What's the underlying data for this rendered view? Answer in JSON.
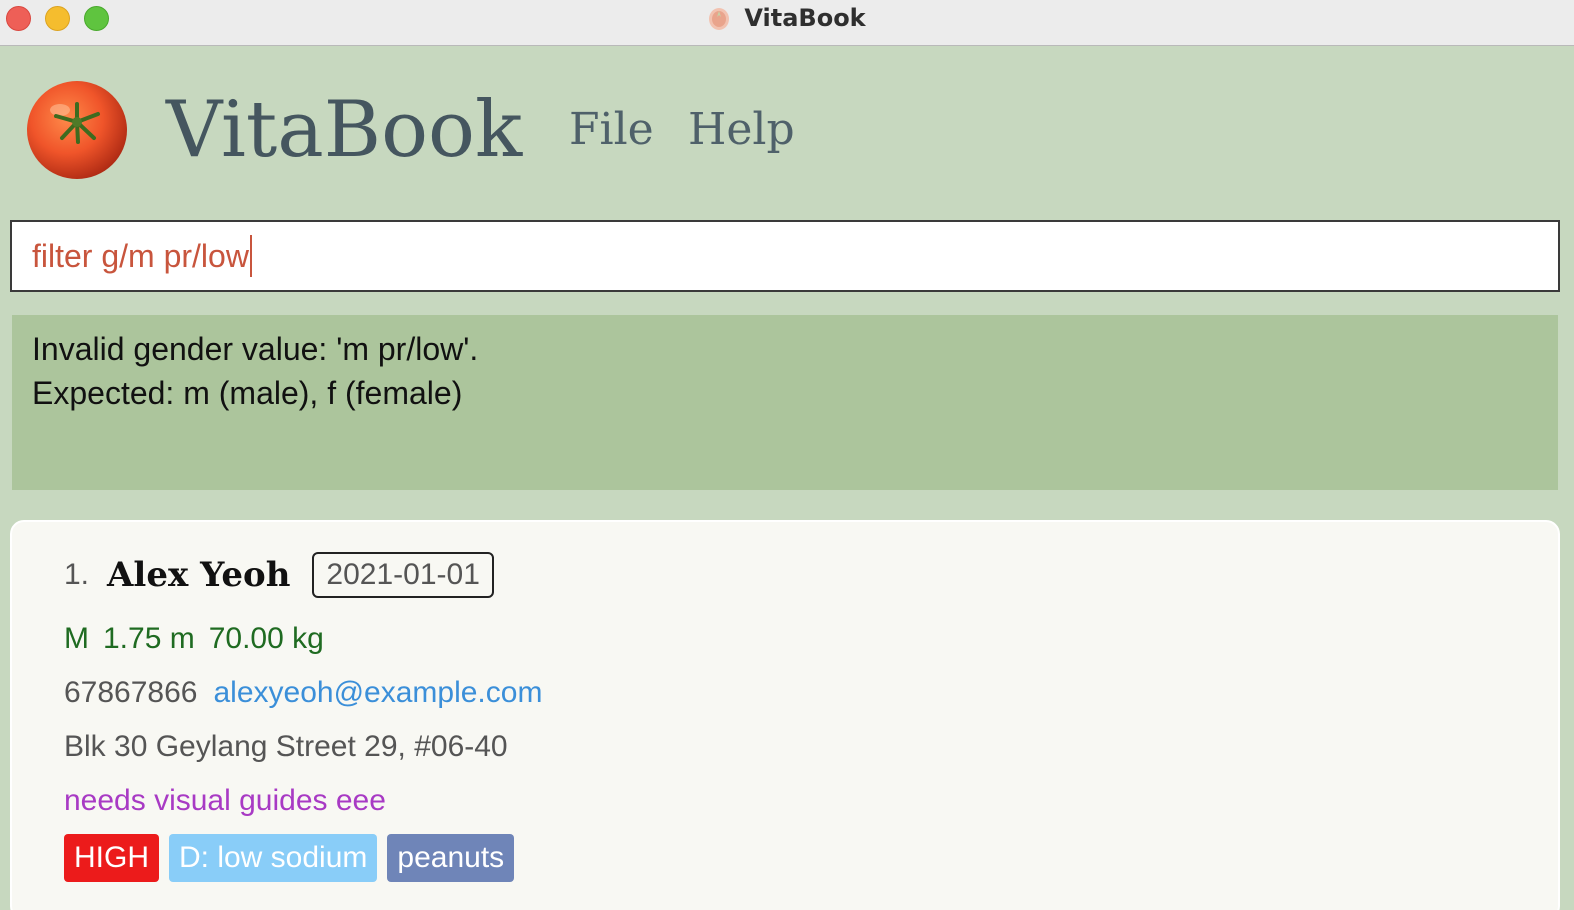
{
  "window": {
    "title": "VitaBook",
    "icon": "tomato-icon"
  },
  "header": {
    "app_name": "VitaBook",
    "menu": [
      {
        "label": "File"
      },
      {
        "label": "Help"
      }
    ]
  },
  "command": {
    "value": "filter g/m pr/low"
  },
  "result": {
    "lines": [
      "Invalid gender value: 'm pr/low'.",
      "Expected: m (male), f (female)"
    ]
  },
  "persons": [
    {
      "index": "1.",
      "name": "Alex Yeoh",
      "date": "2021-01-01",
      "gender": "M",
      "height": "1.75 m",
      "weight": "70.00 kg",
      "phone": "67867866",
      "email": "alexyeoh@example.com",
      "address": "Blk 30 Geylang Street 29, #06-40",
      "remark": "needs visual guides eee",
      "tags": [
        {
          "label": "HIGH",
          "kind": "priority",
          "color": "#ec1b1b"
        },
        {
          "label": "D: low sodium",
          "kind": "diet",
          "color": "#89cdf8"
        },
        {
          "label": "peanuts",
          "kind": "allergy",
          "color": "#6f85b8"
        }
      ]
    }
  ],
  "colors": {
    "background": "#c7d8bf",
    "result_background": "#acc59c",
    "command_text": "#c8553d",
    "vitals_text": "#1f6b21",
    "email_text": "#3b8fd9",
    "remark_text": "#a83ac4"
  }
}
